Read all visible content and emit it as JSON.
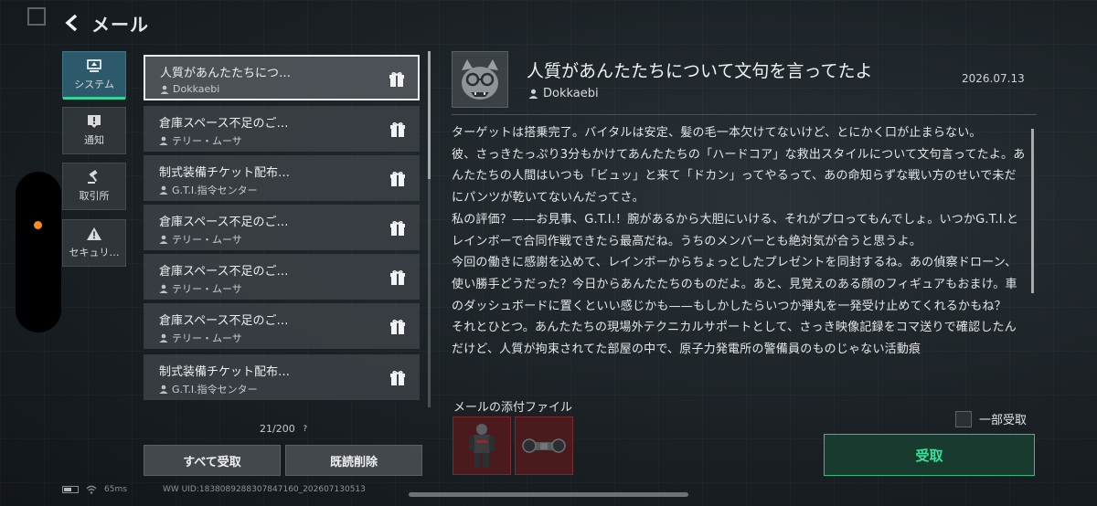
{
  "header": {
    "title": "メール",
    "back_icon": "chevron-left-icon"
  },
  "categories": [
    {
      "label": "システム",
      "icon": "system-icon",
      "active": true
    },
    {
      "label": "通知",
      "icon": "alert-icon",
      "active": false
    },
    {
      "label": "取引所",
      "icon": "gavel-icon",
      "active": false
    },
    {
      "label": "セキュリ…",
      "icon": "warning-icon",
      "active": false
    }
  ],
  "mail_list": {
    "items": [
      {
        "subject": "人質があんたたちにつ…",
        "sender": "Dokkaebi",
        "selected": true
      },
      {
        "subject": "倉庫スペース不足のご…",
        "sender": "テリー・ムーサ"
      },
      {
        "subject": "制式装備チケット配布…",
        "sender": "G.T.I.指令センター"
      },
      {
        "subject": "倉庫スペース不足のご…",
        "sender": "テリー・ムーサ"
      },
      {
        "subject": "倉庫スペース不足のご…",
        "sender": "テリー・ムーサ"
      },
      {
        "subject": "倉庫スペース不足のご…",
        "sender": "テリー・ムーサ"
      },
      {
        "subject": "制式装備チケット配布…",
        "sender": "G.T.I.指令センター"
      }
    ],
    "count": "21/200",
    "help": "?",
    "claim_all": "すべて受取",
    "delete_read": "既読削除"
  },
  "detail": {
    "subject": "人質があんたたちについて文句を言ってたよ",
    "sender": "Dokkaebi",
    "date": "2026.07.13",
    "body": "ターゲットは搭乗完了。バイタルは安定、髪の毛一本欠けてないけど、とにかく口が止まらない。\n彼、さっきたっぷり3分もかけてあんたたちの「ハードコア」な救出スタイルについて文句言ってたよ。あんたたちの人間はいつも「ビュッ」と来て「ドカン」ってやるって、あの命知らずな戦い方のせいで未だにパンツが乾いてないんだってさ。\n私の評価？——お見事、G.T.I.！腕があるから大胆にいける、それがプロってもんでしょ。いつかG.T.I.とレインボーで合同作戦できたら最高だね。うちのメンバーとも絶対気が合うと思うよ。\n今回の働きに感謝を込めて、レインボーからちょっとしたプレゼントを同封するね。あの偵察ドローン、使い勝手どうだった？今日からあんたたちのものだよ。あと、見覚えのある顔のフィギュアもおまけ。車のダッシュボードに置くといい感じかも——もしかしたらいつか弾丸を一発受け止めてくれるかもね？\nそれとひとつ。あんたたちの現場外テクニカルサポートとして、さっき映像記録をコマ送りで確認したんだけど、人質が拘束されてた部屋の中で、原子力発電所の警備員のものじゃない活動痕",
    "attachments_label": "メールの添付ファイル",
    "attachments": [
      {
        "name": "figure-item-icon"
      },
      {
        "name": "drone-item-icon"
      }
    ],
    "partial_label": "一部受取",
    "claim_button": "受取"
  },
  "footer": {
    "ping": "65ms",
    "uid": "WW UID:1838089288307847160_202607130513"
  },
  "colors": {
    "accent_green": "#38e09a",
    "active_tab": "#2d5a6a",
    "attachment_bg": "#4a1a1c",
    "indicator": "#ff8a1f"
  }
}
